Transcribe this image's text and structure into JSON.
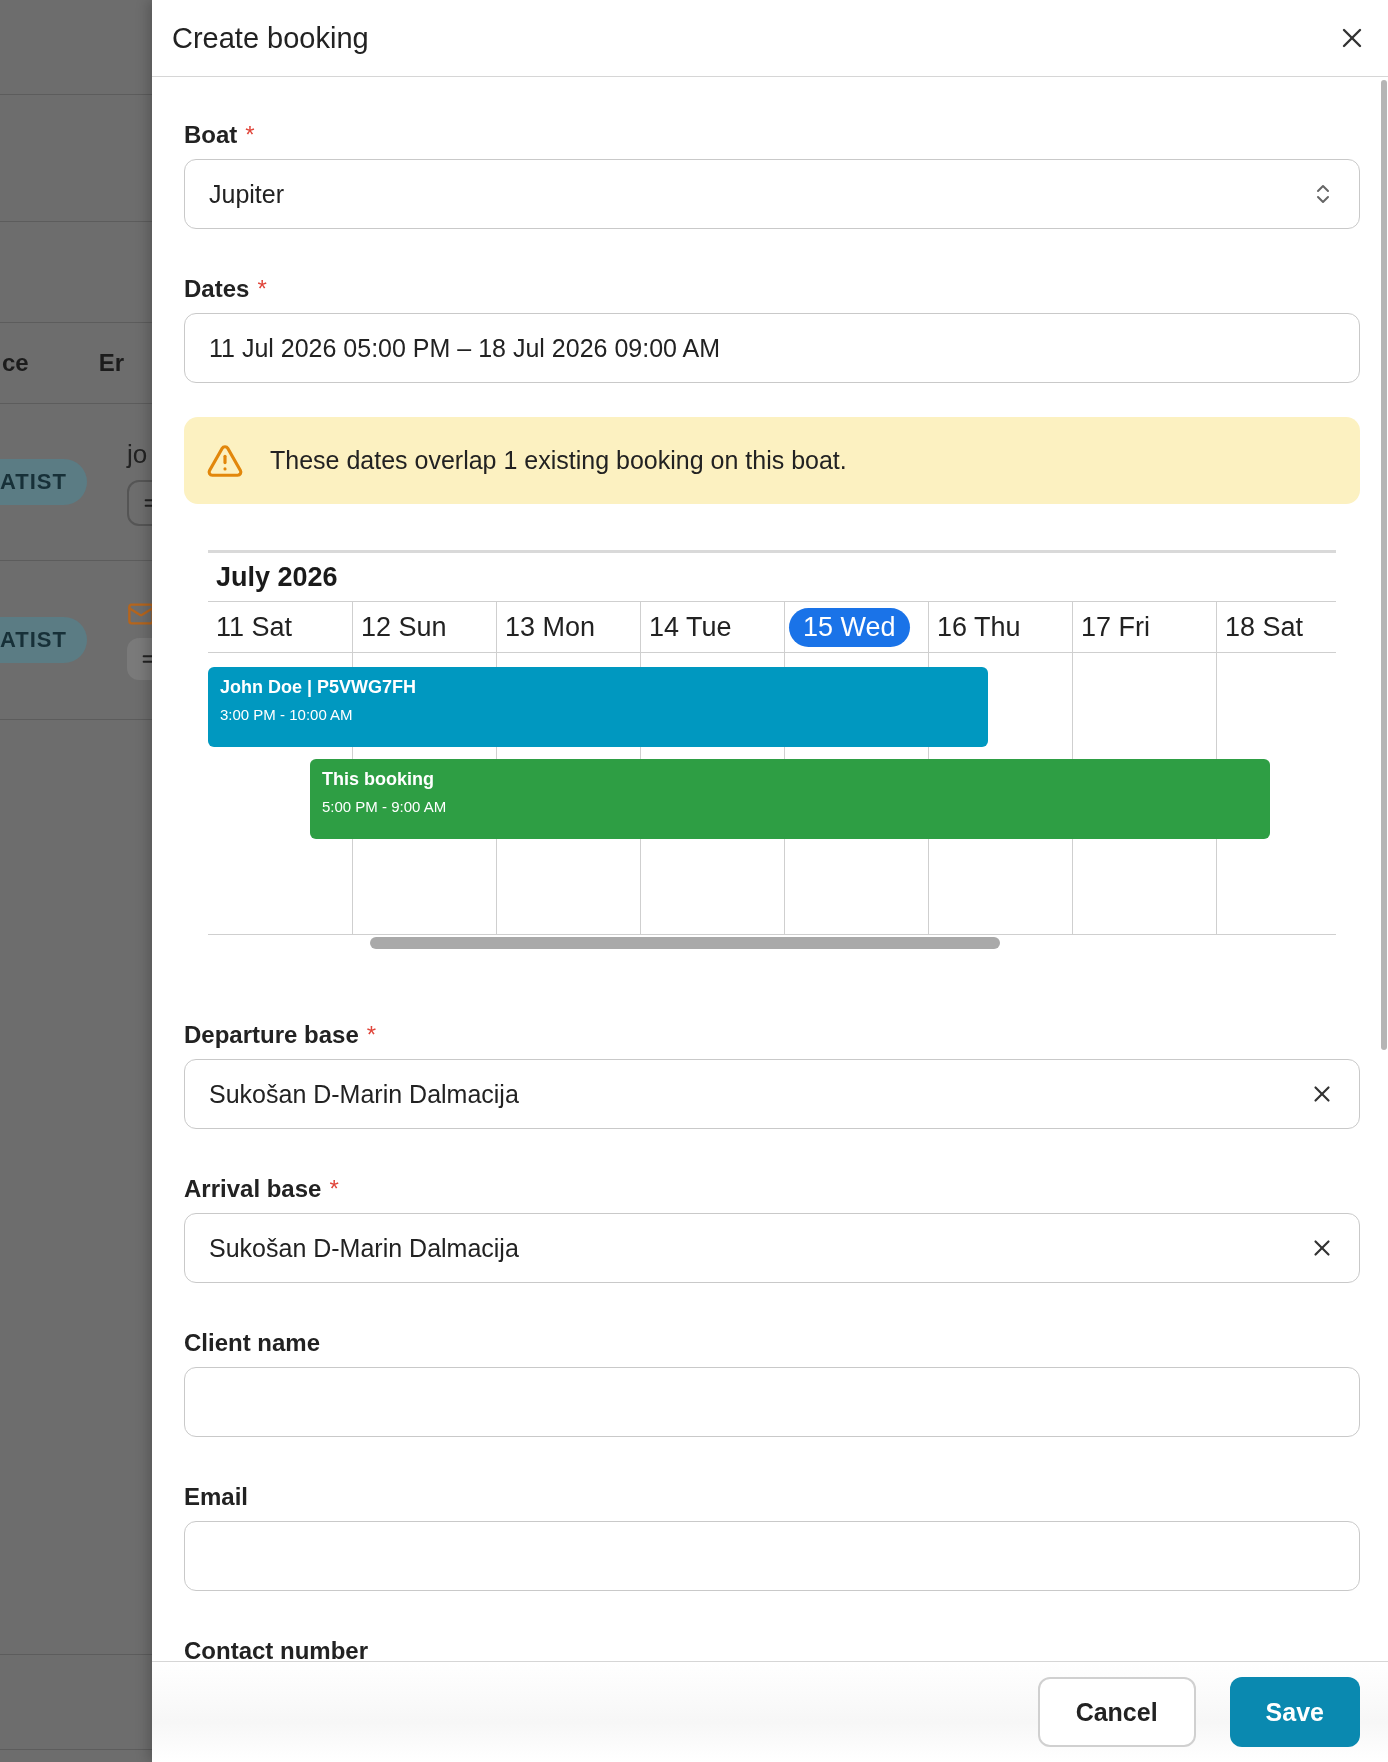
{
  "backdrop": {
    "columns": [
      "ce",
      "Er"
    ],
    "rows": [
      {
        "badge": "ATIST",
        "email": "jo"
      },
      {
        "badge": "ATIST"
      }
    ]
  },
  "drawer": {
    "title": "Create booking"
  },
  "fields_top": [
    {
      "kind": "select",
      "label": "Boat",
      "required_mark": "*",
      "value": "Jupiter"
    },
    {
      "kind": "text",
      "label": "Dates",
      "required_mark": "*",
      "value": "11 Jul 2026 05:00 PM – 18 Jul 2026 09:00 AM"
    }
  ],
  "alert": {
    "kind": "warning",
    "message": "These dates overlap 1 existing booking on this boat."
  },
  "calendar": {
    "month": "July 2026",
    "days": [
      {
        "label": "11 Sat",
        "today": false
      },
      {
        "label": "12 Sun",
        "today": false
      },
      {
        "label": "13 Mon",
        "today": false
      },
      {
        "label": "14 Tue",
        "today": false
      },
      {
        "label": "15 Wed",
        "today": true
      },
      {
        "label": "16 Thu",
        "today": false
      },
      {
        "label": "17 Fri",
        "today": false
      },
      {
        "label": "18 Sat",
        "today": false
      }
    ],
    "events": [
      {
        "title": "John Doe | P5VWG7FH",
        "time": "3:00 PM - 10:00 AM",
        "color": "#0098c0"
      },
      {
        "title": "This booking",
        "time": "5:00 PM - 9:00 AM",
        "color": "#2e9e44"
      }
    ]
  },
  "fields_bottom": [
    {
      "kind": "clearable",
      "label": "Departure base",
      "required_mark": "*",
      "value": "Sukošan D-Marin Dalmacija"
    },
    {
      "kind": "clearable",
      "label": "Arrival base",
      "required_mark": "*",
      "value": "Sukošan D-Marin Dalmacija"
    },
    {
      "kind": "text",
      "label": "Client name"
    },
    {
      "kind": "text",
      "label": "Email"
    },
    {
      "kind": "text",
      "label": "Contact number"
    }
  ],
  "footer": {
    "buttons": [
      {
        "label": "Cancel",
        "kind": "secondary"
      },
      {
        "label": "Save",
        "kind": "primary"
      }
    ]
  }
}
